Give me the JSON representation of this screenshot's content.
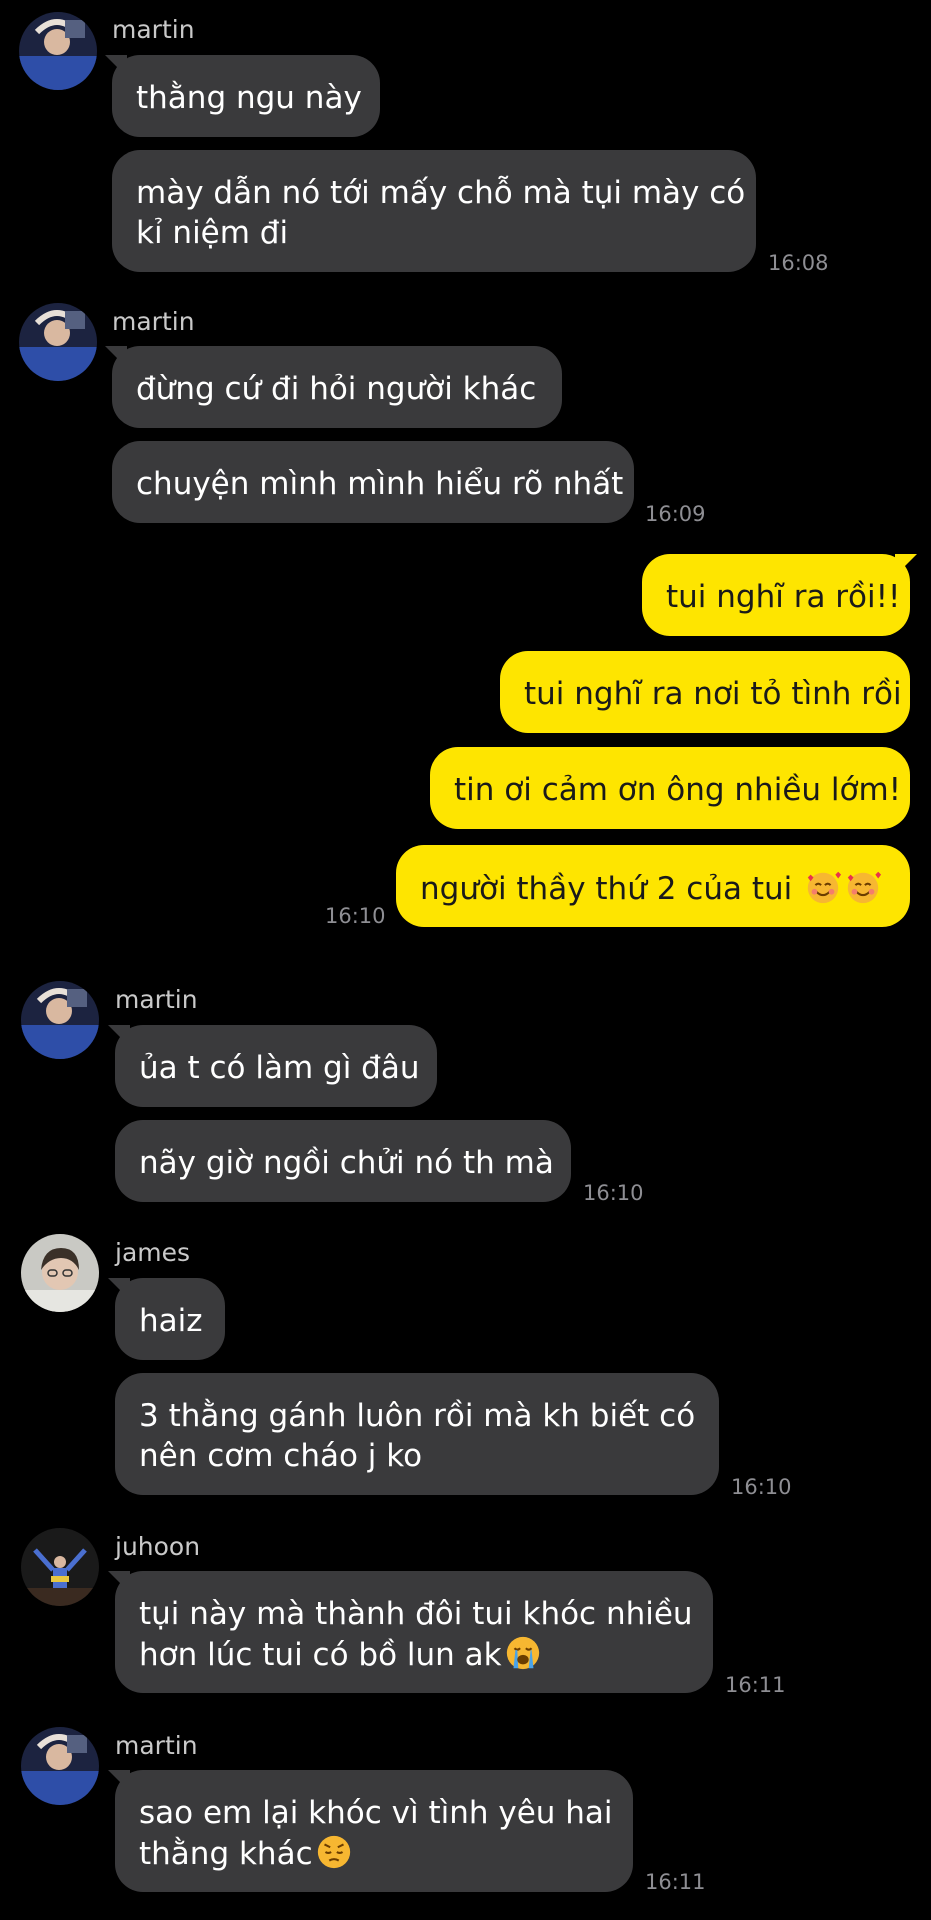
{
  "messages": {
    "g1": {
      "sender": "martin",
      "m1": "thằng ngu này",
      "m2_line1": "mày dẫn nó tới mấy chỗ mà tụi mày có",
      "m2_line2": "kỉ niệm đi",
      "time": "16:08"
    },
    "g2": {
      "sender": "martin",
      "m1": "đừng cứ đi hỏi người khác",
      "m2": "chuyện mình mình hiểu rõ nhất",
      "time": "16:09"
    },
    "g3": {
      "m1": "tui nghĩ ra rồi!!",
      "m2": "tui nghĩ ra nơi tỏ tình rồi",
      "m3": "tin ơi cảm ơn ông nhiều lớm!",
      "m4": "người thầy thứ 2 của tui",
      "time": "16:10"
    },
    "g4": {
      "sender": "martin",
      "m1": "ủa t có làm gì đâu",
      "m2": "nãy giờ ngồi chửi nó th mà",
      "time": "16:10"
    },
    "g5": {
      "sender": "james",
      "m1": "haiz",
      "m2_line1": "3 thằng gánh luôn rồi mà kh biết có",
      "m2_line2": "nên cơm cháo j ko",
      "time": "16:10"
    },
    "g6": {
      "sender": "juhoon",
      "m1_line1": "tụi này mà thành đôi tui khóc nhiều",
      "m1_line2": "hơn lúc tui có bồ lun ak",
      "time": "16:11"
    },
    "g7": {
      "sender": "martin",
      "m1_line1": "sao em lại khóc vì tình yêu hai",
      "m1_line2": "thằng khác",
      "time": "16:11"
    }
  },
  "emojis": {
    "smiling_hearts": "smiling-face-with-hearts-icon",
    "crying": "loudly-crying-face-icon",
    "pensive": "pensive-face-icon"
  },
  "colors": {
    "incoming_bubble": "#3a3a3c",
    "outgoing_bubble": "#fee500",
    "background": "#000000",
    "timestamp": "#8e8e93"
  }
}
